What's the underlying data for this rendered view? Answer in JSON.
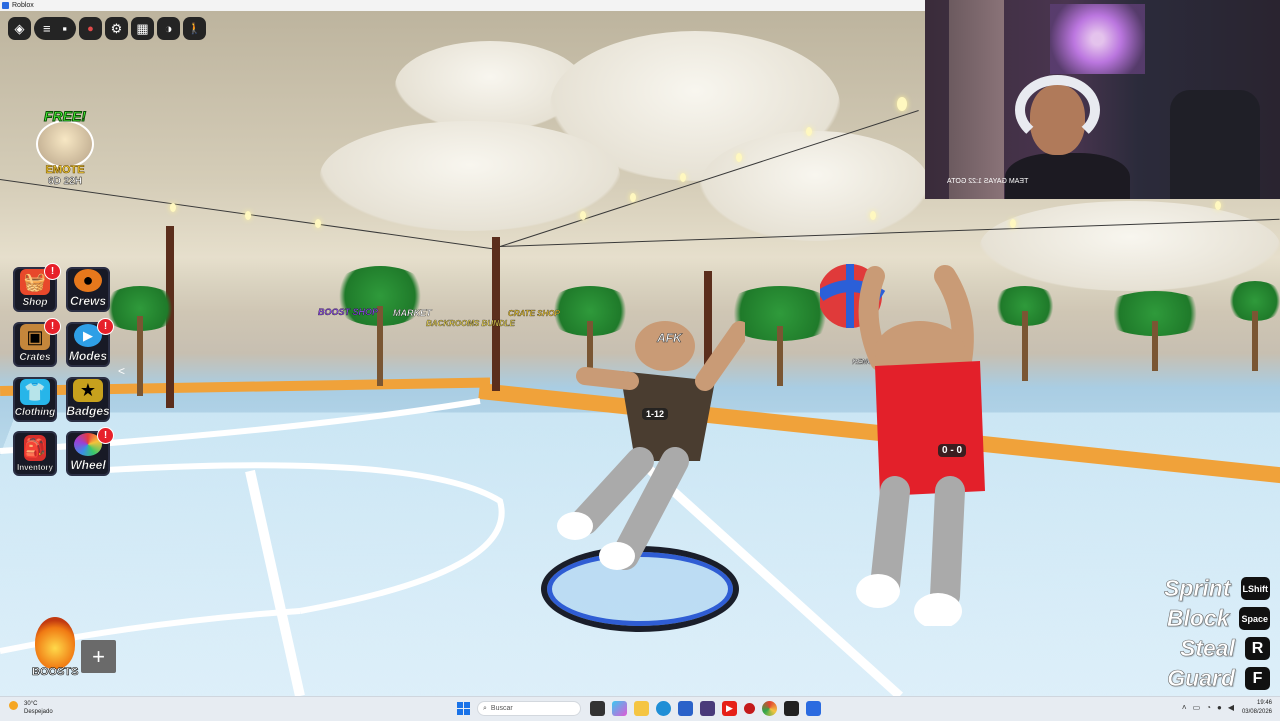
{
  "window": {
    "title": "Roblox"
  },
  "topbar": {
    "buttons": [
      {
        "name": "roblox-menu-button",
        "glyph": "◈"
      },
      {
        "name": "menu-lines-button",
        "glyph": "≡"
      },
      {
        "name": "chat-button",
        "glyph": "▪"
      },
      {
        "name": "settings-button",
        "glyph": "⚙"
      },
      {
        "name": "calendar-button",
        "glyph": "▦"
      },
      {
        "name": "camera-button",
        "glyph": "◑"
      },
      {
        "name": "emote-walk-button",
        "glyph": "🚶"
      }
    ]
  },
  "promo": {
    "free_label": "FREE!",
    "emote_label": "EMOTE",
    "timer": "6D 22H"
  },
  "menu": [
    {
      "id": "shop",
      "label": "Shop",
      "badge": "!",
      "icon": "shopping-basket-icon",
      "color": "#e8482b"
    },
    {
      "id": "crews",
      "label": "Crews",
      "badge": "",
      "icon": "basketball-icon",
      "color": "#e6781c"
    },
    {
      "id": "crates",
      "label": "Crates",
      "badge": "!",
      "icon": "crate-icon",
      "color": "#c4863b"
    },
    {
      "id": "modes",
      "label": "Modes",
      "badge": "!",
      "icon": "play-icon",
      "color": "#2e9fe6"
    },
    {
      "id": "clothing",
      "label": "Clothing",
      "badge": "",
      "icon": "shirt-icon",
      "color": "#27b5e9"
    },
    {
      "id": "badges",
      "label": "Badges",
      "badge": "",
      "icon": "badge-icon",
      "color": "#c7a11d"
    },
    {
      "id": "inventory",
      "label": "Inventory",
      "badge": "",
      "icon": "backpack-icon",
      "color": "#d8302c"
    },
    {
      "id": "wheel",
      "label": "Wheel",
      "badge": "!",
      "icon": "wheel-icon",
      "color": "#9c3fd6"
    }
  ],
  "boosts": {
    "label": "BOOSTS"
  },
  "controls": [
    {
      "name": "Sprint",
      "key": "LShift"
    },
    {
      "name": "Block",
      "key": "Space"
    },
    {
      "name": "Steal",
      "key": "R"
    },
    {
      "name": "Guard",
      "key": "F"
    }
  ],
  "world": {
    "labels": {
      "boost_shop": "BOOST SHOP",
      "market": "MARKET",
      "backrooms": "BACKROOMS BUNDLE",
      "crate_shop": "CRATE SHOP",
      "remove_loss": "REMOVE LOSS",
      "afk": "AFK"
    },
    "player1_tag": "1-12",
    "player2_tag": "0 - 0"
  },
  "webcam": {
    "overlay": "TEAM GAYAS 1:22 GOTA"
  },
  "taskbar": {
    "weather_temp": "30°C",
    "weather_desc": "Despejado",
    "search_placeholder": "Buscar",
    "time": "19:46",
    "date": "03/08/2026"
  }
}
